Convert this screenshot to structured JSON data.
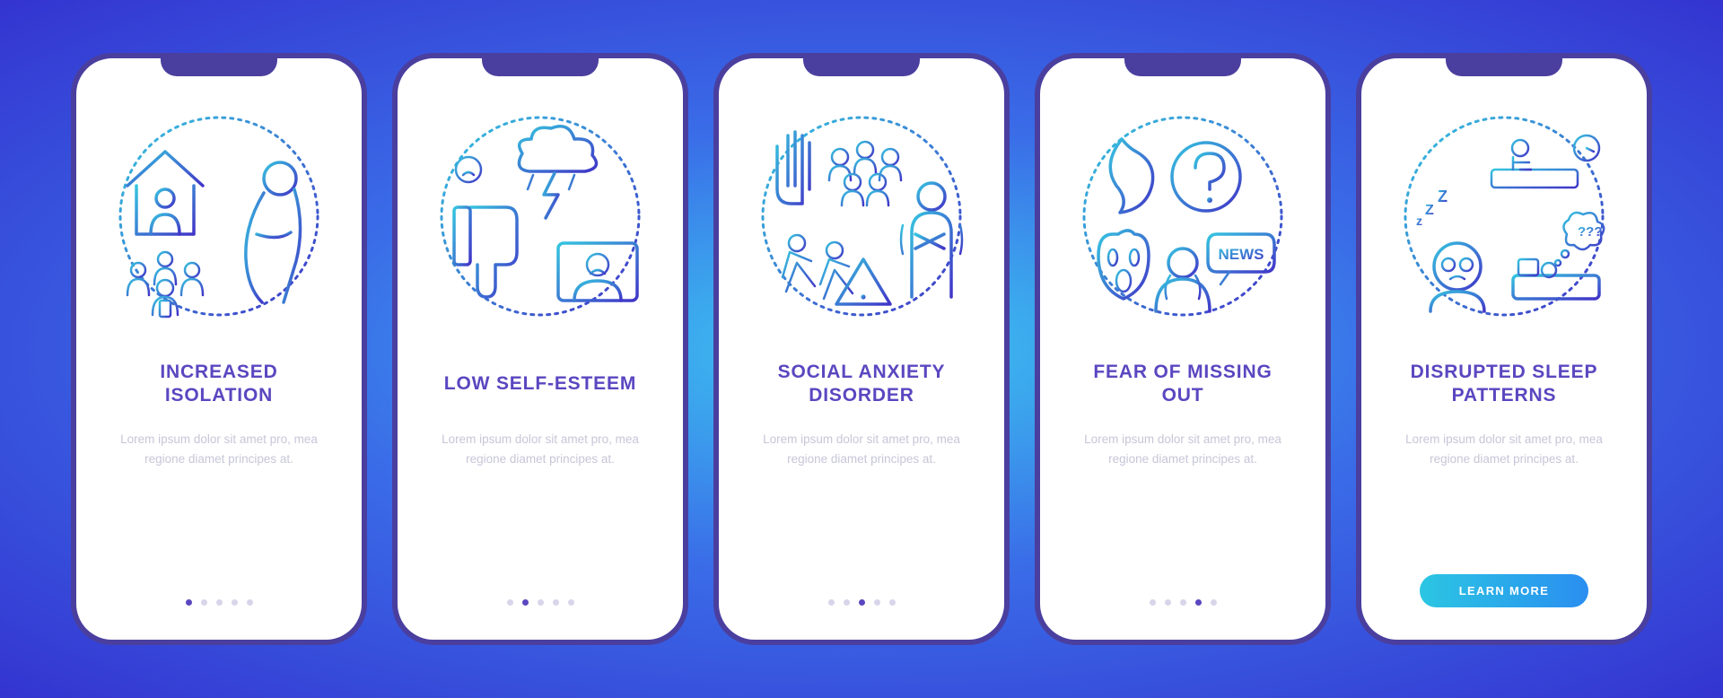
{
  "colors": {
    "frame": "#4a3f9f",
    "title": "#5a47c0",
    "body": "#c7c6d8",
    "btn_grad_start": "#2bc6e3",
    "btn_grad_end": "#2a8ef0",
    "bg_grad_inner": "#3cc7f0",
    "bg_grad_mid": "#3a6de8",
    "bg_grad_outer": "#3434d0"
  },
  "lorem": "Lorem ipsum dolor sit amet pro, mea regione diamet principes at.",
  "learn_more": "LEARN MORE",
  "screens": [
    {
      "title": "INCREASED\nISOLATION",
      "icon": "isolation-icon",
      "active_dot": 0,
      "has_button": false
    },
    {
      "title": "LOW SELF-ESTEEM",
      "icon": "low-esteem-icon",
      "active_dot": 1,
      "has_button": false
    },
    {
      "title": "SOCIAL ANXIETY\nDISORDER",
      "icon": "social-anxiety-icon",
      "active_dot": 2,
      "has_button": false
    },
    {
      "title": "FEAR OF MISSING\nOUT",
      "icon": "fomo-icon",
      "active_dot": 3,
      "has_button": false
    },
    {
      "title": "DISRUPTED SLEEP\nPATTERNS",
      "icon": "sleep-icon",
      "active_dot": 4,
      "has_button": true
    }
  ]
}
